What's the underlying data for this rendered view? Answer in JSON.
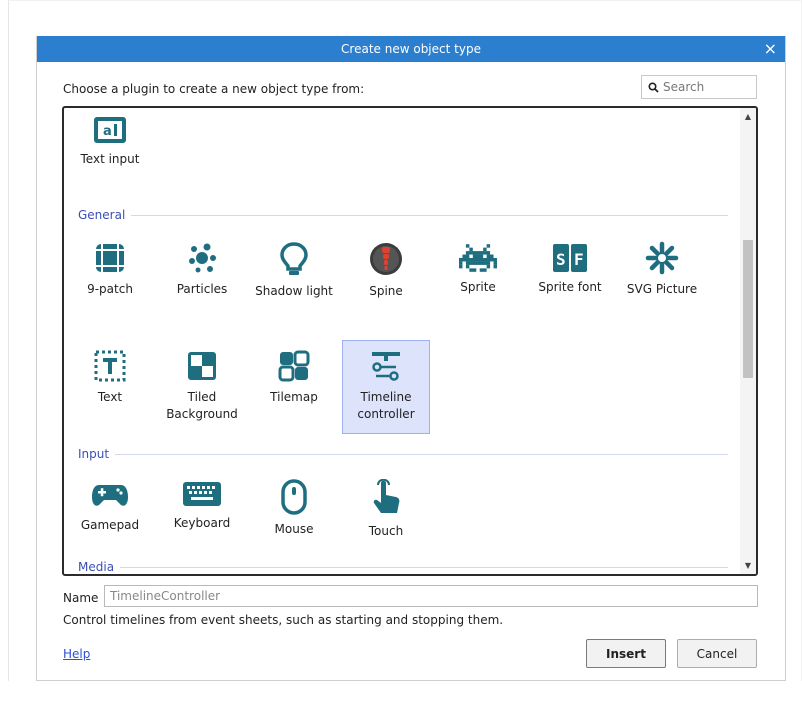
{
  "dialog": {
    "title": "Create new object type",
    "close_glyph": "×",
    "prompt": "Choose a plugin to create a new object type from:",
    "search_placeholder": "Search",
    "name_label": "Name",
    "name_value": "TimelineController",
    "description": "Control timelines from event sheets, such as starting and stopping them.",
    "help_label": "Help",
    "insert_label": "Insert",
    "cancel_label": "Cancel"
  },
  "plugins": {
    "top": [
      {
        "label": "Text input",
        "icon": "text-input-icon"
      }
    ],
    "groups": [
      {
        "name": "General",
        "items": [
          {
            "label": "9-patch",
            "icon": "nine-patch-icon"
          },
          {
            "label": "Particles",
            "icon": "particles-icon"
          },
          {
            "label": "Shadow light",
            "icon": "lightbulb-icon"
          },
          {
            "label": "Spine",
            "icon": "spine-icon"
          },
          {
            "label": "Sprite",
            "icon": "invader-icon"
          },
          {
            "label": "Sprite font",
            "icon": "sprite-font-icon"
          },
          {
            "label": "SVG Picture",
            "icon": "asterisk-icon"
          },
          {
            "label": "Text",
            "icon": "text-icon"
          },
          {
            "label": "Tiled Background",
            "icon": "tiled-background-icon"
          },
          {
            "label": "Tilemap",
            "icon": "tilemap-icon"
          },
          {
            "label": "Timeline controller",
            "icon": "timeline-icon",
            "selected": true
          }
        ]
      },
      {
        "name": "Input",
        "items": [
          {
            "label": "Gamepad",
            "icon": "gamepad-icon"
          },
          {
            "label": "Keyboard",
            "icon": "keyboard-icon"
          },
          {
            "label": "Mouse",
            "icon": "mouse-icon"
          },
          {
            "label": "Touch",
            "icon": "touch-icon"
          }
        ]
      },
      {
        "name": "Media",
        "items": []
      }
    ]
  },
  "colors": {
    "title_bar": "#2c7fcf",
    "icon_teal": "#1f6e80",
    "group_header": "#3a4fb8",
    "selection": "#dde3fb"
  }
}
